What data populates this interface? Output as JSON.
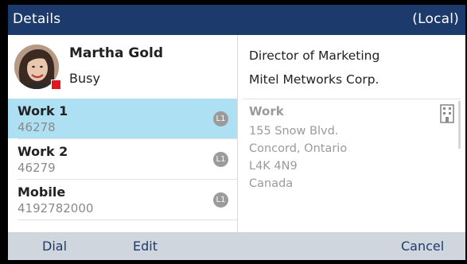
{
  "header": {
    "title": "Details",
    "mode": "(Local)"
  },
  "contact": {
    "name": "Martha Gold",
    "status": "Busy",
    "presence_color": "#e0171f"
  },
  "numbers": [
    {
      "label": "Work 1",
      "number": "46278",
      "line": "L1",
      "selected": true
    },
    {
      "label": "Work 2",
      "number": "46279",
      "line": "L1",
      "selected": false
    },
    {
      "label": "Mobile",
      "number": "4192782000",
      "line": "L1",
      "selected": false
    }
  ],
  "details": {
    "title": "Director of Marketing",
    "company": "Mitel Metworks Corp."
  },
  "address": {
    "type": "Work",
    "icon": "building-icon",
    "lines": [
      "155 Snow Blvd.",
      "Concord, Ontario",
      "L4K 4N9",
      "Canada"
    ]
  },
  "softkeys": {
    "dial": "Dial",
    "edit": "Edit",
    "cancel": "Cancel"
  },
  "colors": {
    "header": "#1d3a6c",
    "selection": "#aee0f4",
    "softkey_bar": "#d0d6de"
  }
}
